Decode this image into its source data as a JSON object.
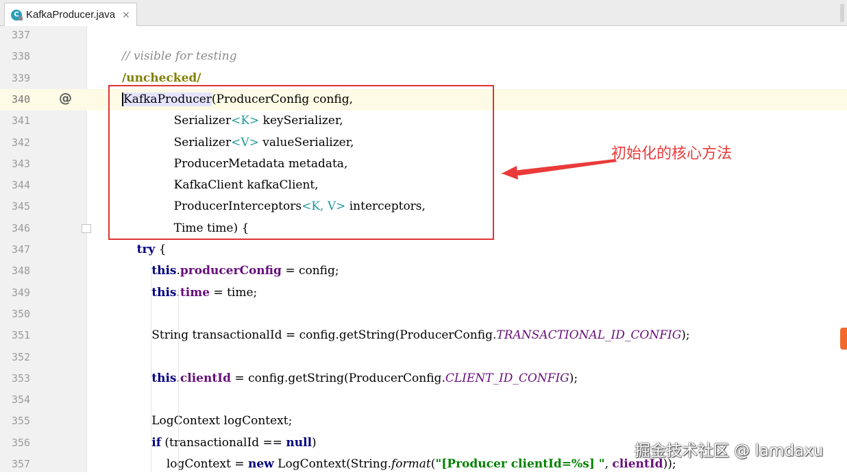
{
  "tab": {
    "icon": "java-class-icon",
    "icon_letter": "C",
    "filename": "KafkaProducer.java",
    "close": "×"
  },
  "annotation": {
    "text": "初始化的核心方法"
  },
  "watermark": "掘金技术社区 @ lamdaxu",
  "colors": {
    "box": "#e03333",
    "annotation": "#ea3a3a",
    "keyword": "#000080",
    "field": "#660e7a",
    "string": "#008000",
    "comment": "#8a8a8a",
    "generic": "#20999d",
    "current_line": "#fdfbe5"
  },
  "lines": [
    {
      "n": "337",
      "tokens": []
    },
    {
      "n": "338",
      "tokens": [
        {
          "t": "// visible for testing",
          "c": "cm"
        }
      ]
    },
    {
      "n": "339",
      "tokens": [
        {
          "t": "/unchecked/",
          "c": "ann"
        }
      ]
    },
    {
      "n": "340",
      "current": true,
      "marker": "@",
      "tokens": [
        {
          "t": "KafkaProducer",
          "c": "hl caret"
        },
        {
          "t": "(ProducerConfig config,",
          "c": ""
        }
      ]
    },
    {
      "n": "341",
      "tokens": [
        {
          "t": "              Serializer",
          "c": ""
        },
        {
          "t": "<K>",
          "c": "gen"
        },
        {
          "t": " keySerializer,",
          "c": ""
        }
      ]
    },
    {
      "n": "342",
      "tokens": [
        {
          "t": "              Serializer",
          "c": ""
        },
        {
          "t": "<V>",
          "c": "gen"
        },
        {
          "t": " valueSerializer,",
          "c": ""
        }
      ]
    },
    {
      "n": "343",
      "tokens": [
        {
          "t": "              ProducerMetadata metadata,",
          "c": ""
        }
      ]
    },
    {
      "n": "344",
      "tokens": [
        {
          "t": "              KafkaClient kafkaClient,",
          "c": ""
        }
      ]
    },
    {
      "n": "345",
      "tokens": [
        {
          "t": "              ProducerInterceptors",
          "c": ""
        },
        {
          "t": "<K, V>",
          "c": "gen"
        },
        {
          "t": " interceptors,",
          "c": ""
        }
      ]
    },
    {
      "n": "346",
      "fold": true,
      "tokens": [
        {
          "t": "              Time time) {",
          "c": ""
        }
      ]
    },
    {
      "n": "347",
      "tokens": [
        {
          "t": "    ",
          "c": ""
        },
        {
          "t": "try",
          "c": "kw"
        },
        {
          "t": " {",
          "c": ""
        }
      ]
    },
    {
      "n": "348",
      "tokens": [
        {
          "t": "        ",
          "c": ""
        },
        {
          "t": "this",
          "c": "kw"
        },
        {
          "t": ".",
          "c": ""
        },
        {
          "t": "producerConfig",
          "c": "fld"
        },
        {
          "t": " = config;",
          "c": ""
        }
      ]
    },
    {
      "n": "349",
      "tokens": [
        {
          "t": "        ",
          "c": ""
        },
        {
          "t": "this",
          "c": "kw"
        },
        {
          "t": ".",
          "c": ""
        },
        {
          "t": "time",
          "c": "fld"
        },
        {
          "t": " = time;",
          "c": ""
        }
      ]
    },
    {
      "n": "350",
      "tokens": []
    },
    {
      "n": "351",
      "tokens": [
        {
          "t": "        String transactionalId = config.getString(ProducerConfig.",
          "c": ""
        },
        {
          "t": "TRANSACTIONAL_ID_CONFIG",
          "c": "cst"
        },
        {
          "t": ");",
          "c": ""
        }
      ]
    },
    {
      "n": "352",
      "tokens": []
    },
    {
      "n": "353",
      "tokens": [
        {
          "t": "        ",
          "c": ""
        },
        {
          "t": "this",
          "c": "kw"
        },
        {
          "t": ".",
          "c": ""
        },
        {
          "t": "clientId",
          "c": "fld"
        },
        {
          "t": " = config.getString(ProducerConfig.",
          "c": ""
        },
        {
          "t": "CLIENT_ID_CONFIG",
          "c": "cst"
        },
        {
          "t": ");",
          "c": ""
        }
      ]
    },
    {
      "n": "354",
      "tokens": []
    },
    {
      "n": "355",
      "tokens": [
        {
          "t": "        LogContext logContext;",
          "c": ""
        }
      ]
    },
    {
      "n": "356",
      "tokens": [
        {
          "t": "        ",
          "c": ""
        },
        {
          "t": "if",
          "c": "kw"
        },
        {
          "t": " (transactionalId == ",
          "c": ""
        },
        {
          "t": "null",
          "c": "kw"
        },
        {
          "t": ")",
          "c": ""
        }
      ]
    },
    {
      "n": "357",
      "tokens": [
        {
          "t": "            logContext = ",
          "c": ""
        },
        {
          "t": "new",
          "c": "kw"
        },
        {
          "t": " LogContext(String.",
          "c": ""
        },
        {
          "t": "format",
          "c": "it"
        },
        {
          "t": "(",
          "c": ""
        },
        {
          "t": "\"[Producer clientId=%s] \"",
          "c": "str"
        },
        {
          "t": ", ",
          "c": ""
        },
        {
          "t": "clientId",
          "c": "fld"
        },
        {
          "t": "));",
          "c": ""
        }
      ]
    }
  ]
}
